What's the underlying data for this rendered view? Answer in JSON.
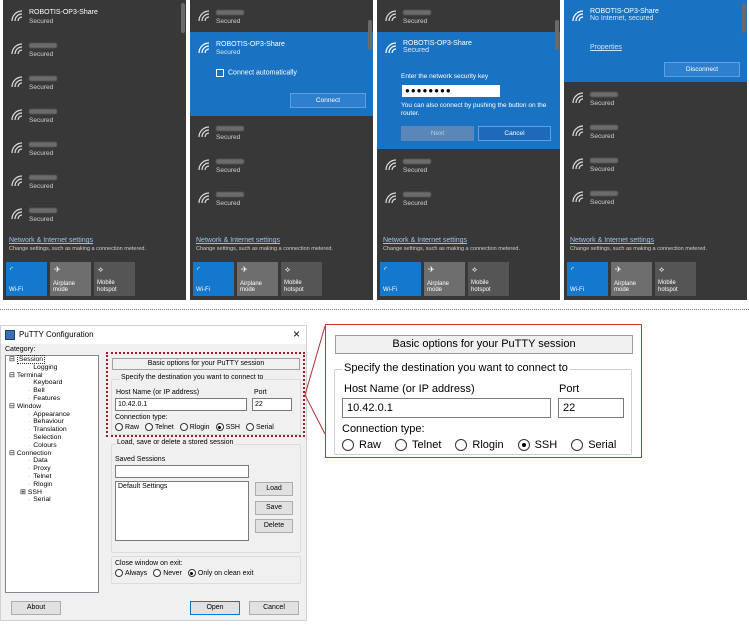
{
  "wifi_panels": [
    {
      "networks": [
        {
          "name": "ROBOTIS-OP3-Share",
          "status": "Secured",
          "selected": false
        },
        {
          "name": "",
          "status": "Secured"
        },
        {
          "name": "",
          "status": "Secured"
        },
        {
          "name": "",
          "status": "Secured"
        },
        {
          "name": "",
          "status": "Secured"
        },
        {
          "name": "",
          "status": "Secured"
        },
        {
          "name": "",
          "status": "Secured"
        }
      ]
    },
    {
      "networks_top": [
        {
          "name": "",
          "status": "Secured"
        }
      ],
      "expanded": {
        "name": "ROBOTIS-OP3-Share",
        "status": "Secured",
        "checkbox_label": "Connect automatically",
        "connect_label": "Connect"
      },
      "networks": [
        {
          "name": "",
          "status": "Secured"
        },
        {
          "name": "",
          "status": "Secured"
        },
        {
          "name": "",
          "status": "Secured"
        }
      ]
    },
    {
      "networks_top": [
        {
          "name": "",
          "status": "Secured"
        }
      ],
      "expanded": {
        "name": "ROBOTIS-OP3-Share",
        "status": "Secured",
        "prompt": "Enter the network security key",
        "password": "●●●●●●●●",
        "hint": "You can also connect by pushing the button on the router.",
        "next_label": "Next",
        "cancel_label": "Cancel"
      },
      "networks": [
        {
          "name": "",
          "status": "Secured"
        },
        {
          "name": "",
          "status": "Secured"
        }
      ]
    },
    {
      "expanded": {
        "name": "ROBOTIS-OP3-Share",
        "status": "No Internet, secured",
        "properties_label": "Properties",
        "disconnect_label": "Disconnect"
      },
      "networks": [
        {
          "name": "",
          "status": "Secured"
        },
        {
          "name": "",
          "status": "Secured"
        },
        {
          "name": "",
          "status": "Secured"
        },
        {
          "name": "",
          "status": "Secured"
        }
      ]
    }
  ],
  "wifi_footer": {
    "settings_link": "Network & Internet settings",
    "settings_sub": "Change settings, such as making a connection metered.",
    "tile_wifi": "Wi-Fi",
    "tile_airplane": "Airplane mode",
    "tile_mobile_1": "Mobile",
    "tile_mobile_2": "hotspot"
  },
  "putty": {
    "title": "PuTTY Configuration",
    "close": "×",
    "category_label": "Category:",
    "tree": [
      {
        "label": "Session",
        "level": 0,
        "expander": "−"
      },
      {
        "label": "Logging",
        "level": 2
      },
      {
        "label": "Terminal",
        "level": 0,
        "expander": "−"
      },
      {
        "label": "Keyboard",
        "level": 2
      },
      {
        "label": "Bell",
        "level": 2
      },
      {
        "label": "Features",
        "level": 2
      },
      {
        "label": "Window",
        "level": 0,
        "expander": "−"
      },
      {
        "label": "Appearance",
        "level": 2
      },
      {
        "label": "Behaviour",
        "level": 2
      },
      {
        "label": "Translation",
        "level": 2
      },
      {
        "label": "Selection",
        "level": 2
      },
      {
        "label": "Colours",
        "level": 2
      },
      {
        "label": "Connection",
        "level": 0,
        "expander": "−"
      },
      {
        "label": "Data",
        "level": 2
      },
      {
        "label": "Proxy",
        "level": 2
      },
      {
        "label": "Telnet",
        "level": 2
      },
      {
        "label": "Rlogin",
        "level": 2
      },
      {
        "label": "SSH",
        "level": 1,
        "expander": "+"
      },
      {
        "label": "Serial",
        "level": 2
      }
    ],
    "header": "Basic options for your PuTTY session",
    "dest_label": "Specify the destination you want to connect to",
    "host_label": "Host Name (or IP address)",
    "port_label": "Port",
    "host_value": "10.42.0.1",
    "port_value": "22",
    "conn_type_label": "Connection type:",
    "conn_types": [
      "Raw",
      "Telnet",
      "Rlogin",
      "SSH",
      "Serial"
    ],
    "conn_selected": "SSH",
    "sessions_group": "Load, save or delete a stored session",
    "saved_sessions_label": "Saved Sessions",
    "saved_sessions_value": "",
    "sessions_list": [
      "Default Settings"
    ],
    "load_label": "Load",
    "save_label": "Save",
    "delete_label": "Delete",
    "close_exit_label": "Close window on exit:",
    "close_options": [
      "Always",
      "Never",
      "Only on clean exit"
    ],
    "close_selected": "Only on clean exit",
    "about_label": "About",
    "open_label": "Open",
    "cancel_label": "Cancel"
  }
}
